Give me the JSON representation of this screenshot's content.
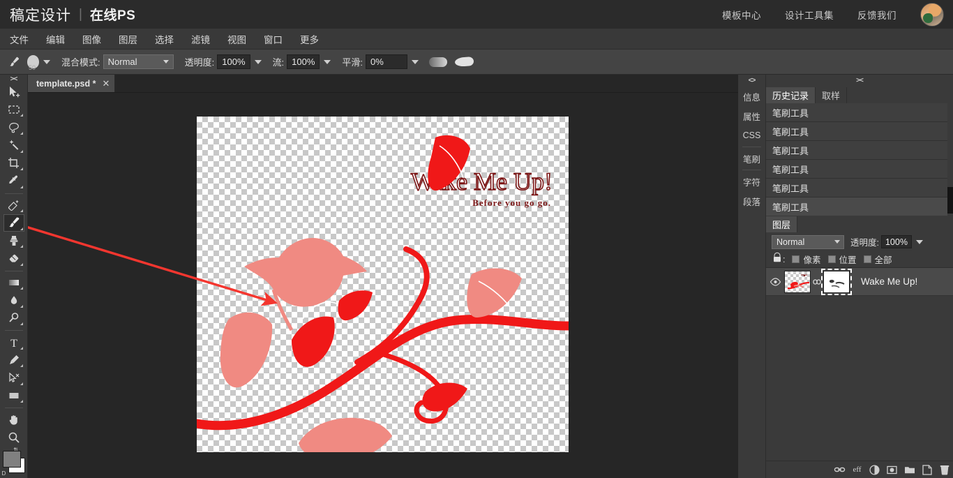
{
  "brand": {
    "logo": "稿定设计",
    "separator": "|",
    "subtitle": "在线PS",
    "links": [
      "模板中心",
      "设计工具集",
      "反馈我们"
    ],
    "avatar_alt": "user-avatar"
  },
  "menubar": {
    "items": [
      "文件",
      "编辑",
      "图像",
      "图层",
      "选择",
      "滤镜",
      "视图",
      "窗口",
      "更多"
    ]
  },
  "options_bar": {
    "brush_icon": "brush-icon",
    "brush_size": "50",
    "blend_mode_label": "混合模式:",
    "blend_mode_value": "Normal",
    "opacity_label": "透明度:",
    "opacity_value": "100%",
    "flow_label": "流:",
    "flow_value": "100%",
    "smoothing_label": "平滑:",
    "smoothing_value": "0%",
    "preset_icon_1": "airbrush-icon",
    "preset_icon_2": "pressure-size-icon"
  },
  "toolbar": {
    "collapse_icon": "collapse-chevrons-icon",
    "tools": [
      {
        "name": "move-tool",
        "icon": "move-cursor-icon",
        "has_submenu": false,
        "active": false
      },
      {
        "name": "marquee-tool",
        "icon": "rectangular-marquee-icon",
        "has_submenu": true,
        "active": false
      },
      {
        "name": "lasso-tool",
        "icon": "lasso-icon",
        "has_submenu": true,
        "active": false
      },
      {
        "name": "magic-wand-tool",
        "icon": "magic-wand-icon",
        "has_submenu": true,
        "active": false
      },
      {
        "name": "crop-tool",
        "icon": "crop-icon",
        "has_submenu": true,
        "active": false
      },
      {
        "name": "eyedropper-tool",
        "icon": "eyedropper-icon",
        "has_submenu": true,
        "active": false
      },
      {
        "name": "healing-brush-tool",
        "icon": "patch-healing-icon",
        "has_submenu": true,
        "active": false
      },
      {
        "name": "brush-tool",
        "icon": "brush-icon",
        "has_submenu": true,
        "active": true
      },
      {
        "name": "clone-stamp-tool",
        "icon": "clone-stamp-icon",
        "has_submenu": true,
        "active": false
      },
      {
        "name": "eraser-tool",
        "icon": "eraser-icon",
        "has_submenu": true,
        "active": false
      },
      {
        "name": "gradient-tool",
        "icon": "gradient-icon",
        "has_submenu": true,
        "active": false
      },
      {
        "name": "blur-tool",
        "icon": "water-drop-icon",
        "has_submenu": true,
        "active": false
      },
      {
        "name": "dodge-tool",
        "icon": "dodge-lollipop-icon",
        "has_submenu": true,
        "active": false
      },
      {
        "name": "type-tool",
        "icon": "text-t-icon",
        "has_submenu": true,
        "active": false
      },
      {
        "name": "pen-tool",
        "icon": "pen-nib-icon",
        "has_submenu": true,
        "active": false
      },
      {
        "name": "path-selection-tool",
        "icon": "path-arrow-icon",
        "has_submenu": true,
        "active": false
      },
      {
        "name": "shape-tool",
        "icon": "rectangle-shape-icon",
        "has_submenu": true,
        "active": false
      },
      {
        "name": "hand-tool",
        "icon": "hand-icon",
        "has_submenu": false,
        "active": false
      },
      {
        "name": "zoom-tool",
        "icon": "magnifier-icon",
        "has_submenu": false,
        "active": false
      }
    ],
    "swatches": {
      "foreground_color": "#808080",
      "background_color": "#ffffff",
      "swap_icon": "swap-colors-icon",
      "default_icon": "default-colors-icon",
      "swap_label": "⇅",
      "default_label": "D"
    }
  },
  "document_tabs": [
    {
      "title": "template.psd *",
      "close_icon": "close-icon",
      "active": true
    }
  ],
  "canvas": {
    "artwork_title": "Wake Me Up!",
    "artwork_subtitle": "Before you go go.",
    "transparent_background": true,
    "colors": {
      "primary_red": "#f01818",
      "soft_red": "#f28f86",
      "text_dark_red": "#7b1414",
      "annotation_red": "#f4362f"
    },
    "annotation": {
      "type": "arrow",
      "from": "brush-tool",
      "to": "bird-shape"
    }
  },
  "right_dock": {
    "collapse_icon_left": "<>",
    "collapse_icon_panel": "><",
    "vertical_tabs": [
      {
        "label": "信息",
        "name": "info"
      },
      {
        "label": "属性",
        "name": "properties"
      },
      {
        "label": "CSS",
        "name": "css"
      },
      {
        "label": "笔刷",
        "name": "brushes"
      },
      {
        "label": "字符",
        "name": "character"
      },
      {
        "label": "段落",
        "name": "paragraph"
      }
    ],
    "history_panel": {
      "tabs": [
        {
          "label": "历史记录",
          "active": true
        },
        {
          "label": "取样",
          "active": false
        }
      ],
      "items": [
        {
          "label": "笔刷工具",
          "current": false
        },
        {
          "label": "笔刷工具",
          "current": false
        },
        {
          "label": "笔刷工具",
          "current": false
        },
        {
          "label": "笔刷工具",
          "current": false
        },
        {
          "label": "笔刷工具",
          "current": false
        },
        {
          "label": "笔刷工具",
          "current": true
        }
      ]
    },
    "layers_panel": {
      "tabs": [
        {
          "label": "图层",
          "active": true
        }
      ],
      "blend_mode": "Normal",
      "opacity_label": "透明度:",
      "opacity_value": "100%",
      "lock_label": "锁定:",
      "lock_options": [
        {
          "label": "像素",
          "checked": false
        },
        {
          "label": "位置",
          "checked": false
        },
        {
          "label": "全部",
          "checked": false
        }
      ],
      "layers": [
        {
          "name": "Wake Me Up!",
          "visible": true,
          "linked": true,
          "mask_selected": true,
          "eye_icon": "eye-icon",
          "link_icon": "link-icon"
        }
      ],
      "bottom_icons": [
        {
          "name": "link-layers-icon",
          "glyph": "GD"
        },
        {
          "name": "layer-effects-icon",
          "glyph": "eff"
        },
        {
          "name": "adjustment-layer-icon",
          "glyph": "half-circle"
        },
        {
          "name": "layer-mask-icon",
          "glyph": "mask"
        },
        {
          "name": "new-group-icon",
          "glyph": "folder"
        },
        {
          "name": "new-layer-icon",
          "glyph": "page"
        },
        {
          "name": "delete-layer-icon",
          "glyph": "trash"
        }
      ]
    }
  }
}
